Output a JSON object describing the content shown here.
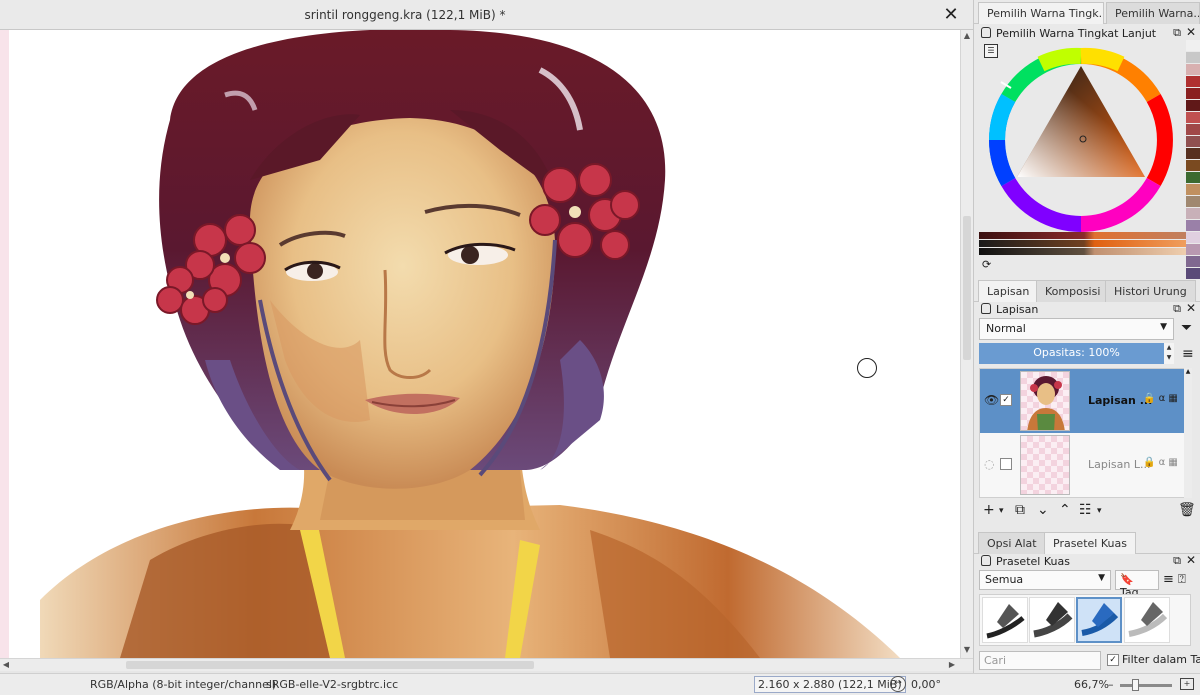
{
  "document": {
    "title": "srintil ronggeng.kra (122,1 MiB) *",
    "close_glyph": "✕"
  },
  "status": {
    "color_model": "RGB/Alpha (8-bit integer/channel)",
    "profile": "sRGB-elle-V2-srgbtrc.icc",
    "image_size": "2.160 x 2.880 (122,1 MiB)",
    "rotation": "0,00°",
    "zoom": "66,7%"
  },
  "dock": {
    "top_tabs": [
      "Pemilih Warna Tingk...",
      "Pemilih Warna..."
    ],
    "color_docker_title": "Pemilih Warna Tingkat Lanjut",
    "layer_tabs": [
      "Lapisan",
      "Komposisi",
      "Histori Urung"
    ],
    "layer_docker_title": "Lapisan",
    "blend_mode": "Normal",
    "opacity_label": "Opasitas:  100%",
    "layers": [
      {
        "name": "Lapisan ...",
        "visible": true,
        "checked": true,
        "selected": true
      },
      {
        "name": "Lapisan L...",
        "visible": false,
        "checked": false,
        "selected": false
      }
    ],
    "tool_tabs": [
      "Opsi Alat",
      "Prasetel Kuas"
    ],
    "brush_docker_title": "Prasetel Kuas",
    "brush_filter": "Semua",
    "tag_label": "Tag",
    "search_placeholder": "Cari",
    "filter_in_tag_label": "Filter dalam Tag",
    "filter_in_tag_checked": true
  },
  "colors": {
    "accent": "#5d90c7",
    "opacity_bar": "#6a9bd1",
    "swatches": [
      "#f0f0f0",
      "#c8c8c8",
      "#d8b0b0",
      "#b03030",
      "#8a2020",
      "#601818",
      "#c05050",
      "#a04848",
      "#905050",
      "#583020",
      "#7a4a20",
      "#3c6a30",
      "#c09060",
      "#a08870",
      "#c8b0b8",
      "#9a80a8",
      "#e0d0e0",
      "#b898b0",
      "#806890",
      "#5a4a78"
    ]
  }
}
